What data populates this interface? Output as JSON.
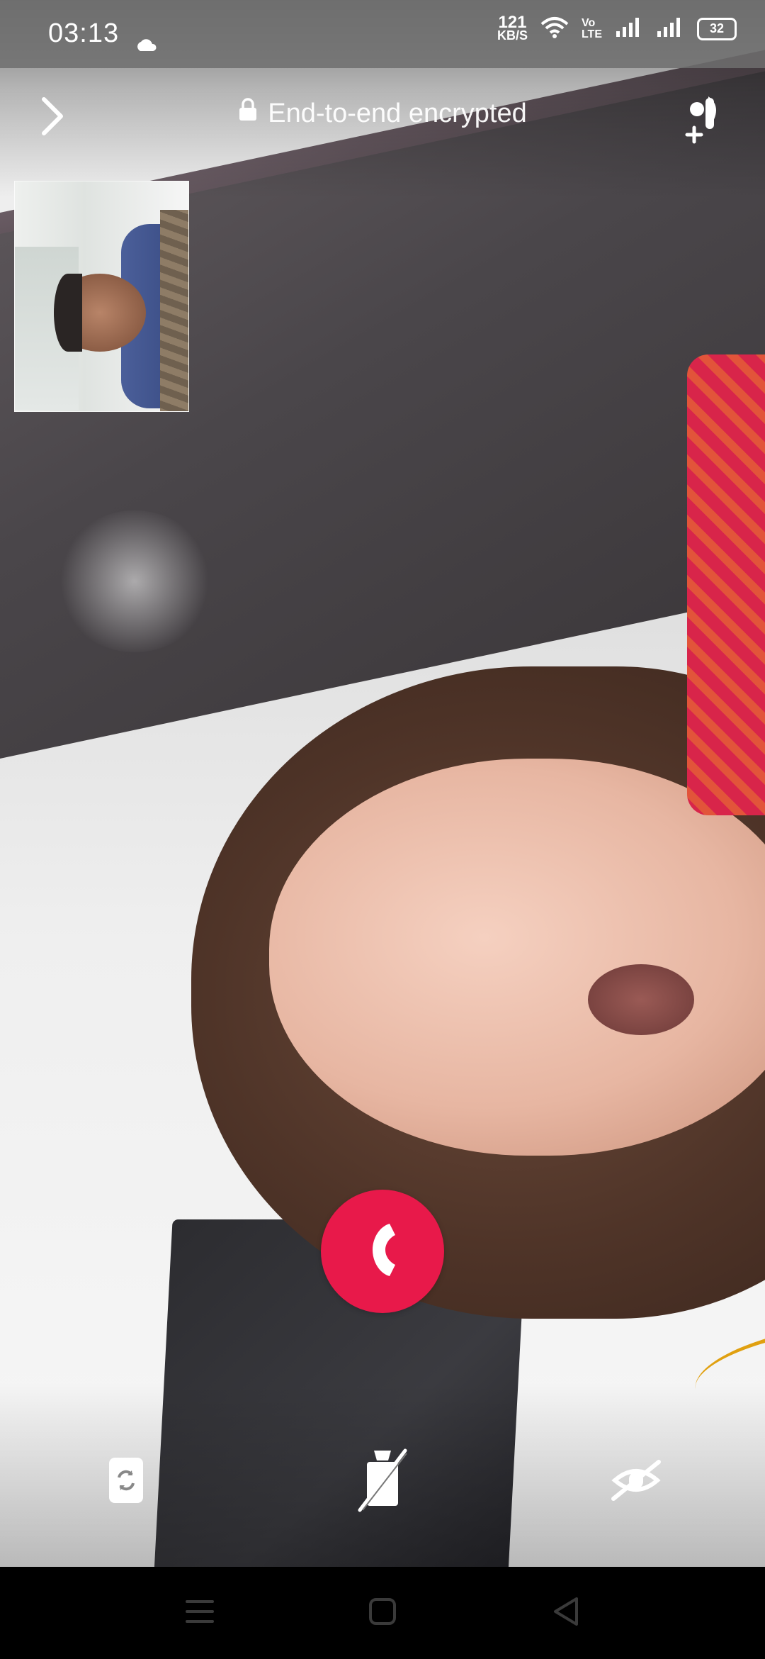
{
  "status_bar": {
    "time": "03:13",
    "net_speed_value": "121",
    "net_speed_unit": "KB/S",
    "volte_top": "Vo",
    "volte_bottom": "LTE",
    "battery_level": "32",
    "icons": [
      "cloud-icon",
      "wifi-icon",
      "volte-icon",
      "signal-icon",
      "signal-icon",
      "battery-icon"
    ]
  },
  "call_header": {
    "encryption_text": "End-to-end encrypted",
    "icons": [
      "chevron-right-icon",
      "lock-icon",
      "add-person-icon"
    ]
  },
  "call_controls": {
    "icons": [
      "end-call-icon",
      "switch-camera-icon",
      "video-off-icon",
      "mute-icon"
    ]
  },
  "navigation_bar": {
    "icons": [
      "menu-icon",
      "home-icon",
      "back-icon"
    ]
  },
  "colors": {
    "end_call": "#e8194a",
    "status_bar": "#6e6e6e",
    "nav_bar": "#000000"
  }
}
